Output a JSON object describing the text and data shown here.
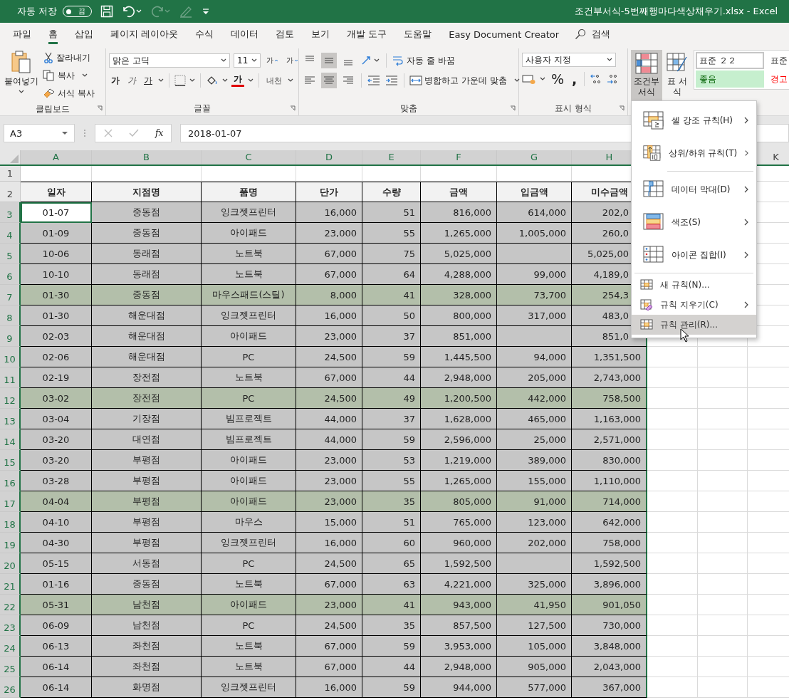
{
  "title_bar": {
    "autosave_label": "자동 저장",
    "autosave_toggle": {
      "label": "끔",
      "on": false
    },
    "quick_access": [
      {
        "kind": "save",
        "disabled": false
      },
      {
        "kind": "undo",
        "disabled": false
      },
      {
        "kind": "redo",
        "disabled": true
      },
      {
        "kind": "pen",
        "disabled": true
      },
      {
        "kind": "customize",
        "disabled": false
      }
    ],
    "title": "조건부서식-5번째행마다색상채우기.xlsx  -  Excel"
  },
  "tabs": [
    {
      "label": "파일",
      "selected": false
    },
    {
      "label": "홈",
      "selected": true
    },
    {
      "label": "삽입",
      "selected": false
    },
    {
      "label": "페이지 레이아웃",
      "selected": false
    },
    {
      "label": "수식",
      "selected": false
    },
    {
      "label": "데이터",
      "selected": false
    },
    {
      "label": "검토",
      "selected": false
    },
    {
      "label": "보기",
      "selected": false
    },
    {
      "label": "개발 도구",
      "selected": false
    },
    {
      "label": "도움말",
      "selected": false
    },
    {
      "label": "Easy Document Creator",
      "selected": false
    }
  ],
  "search": {
    "label": "검색"
  },
  "ribbon": {
    "clipboard": {
      "label": "클립보드",
      "paste": "붙여넣기",
      "cut": "잘라내기",
      "copy": "복사",
      "format_painter": "서식 복사"
    },
    "font": {
      "label": "글꼴",
      "font_name": "맑은 고딕",
      "font_size": "11",
      "grow": "가",
      "shrink": "가",
      "bold": "가",
      "italic": "가",
      "underline": "가",
      "font_color": "가",
      "phonetic": "내천"
    },
    "alignment": {
      "label": "맞춤",
      "vertical": [
        {
          "kind": "top",
          "selected": false
        },
        {
          "kind": "middle",
          "selected": true
        },
        {
          "kind": "bottom",
          "selected": false
        }
      ],
      "horizontal": [
        {
          "kind": "left",
          "selected": false
        },
        {
          "kind": "center",
          "selected": true
        },
        {
          "kind": "right",
          "selected": false
        }
      ],
      "wrap_text": "자동 줄 바꿈",
      "merge_center": "병합하고 가운데 맞춤"
    },
    "number": {
      "label": "표시 형식",
      "format": "사용자 지정",
      "percent": "%",
      "comma": ","
    },
    "styles": {
      "conditional_formatting": {
        "label": "조건부 서식",
        "expanded": true
      },
      "format_as_table": "표 서식",
      "gallery": [
        {
          "label": "표준 ２２",
          "kind": "normal",
          "selected": true
        },
        {
          "label": "표준",
          "kind": "normal",
          "selected": false
        },
        {
          "label": "좋음",
          "kind": "good",
          "selected": false
        },
        {
          "label": "경고",
          "kind": "bad",
          "selected": false
        }
      ]
    }
  },
  "formula_bar": {
    "name_box": "A3",
    "fx": "fx",
    "formula": "2018-01-07"
  },
  "sheet": {
    "columns": [
      {
        "label": "A",
        "selected": true
      },
      {
        "label": "B",
        "selected": true
      },
      {
        "label": "C",
        "selected": true
      },
      {
        "label": "D",
        "selected": true
      },
      {
        "label": "E",
        "selected": true
      },
      {
        "label": "F",
        "selected": true
      },
      {
        "label": "G",
        "selected": true
      },
      {
        "label": "H",
        "selected": true
      },
      {
        "label": "K",
        "selected": false
      }
    ],
    "blank_row_number": "1",
    "header_row_number": "2",
    "headers": [
      "일자",
      "지점명",
      "품명",
      "단가",
      "수량",
      "금액",
      "입금액",
      "미수금액"
    ],
    "rows": [
      {
        "number": "3",
        "highlight": false,
        "active": true,
        "cells": [
          "01-07",
          "중동점",
          "잉크젯프린터",
          "16,000",
          "51",
          "816,000",
          "614,000",
          "202,0"
        ]
      },
      {
        "number": "4",
        "highlight": false,
        "active": false,
        "cells": [
          "01-09",
          "중동점",
          "아이패드",
          "23,000",
          "55",
          "1,265,000",
          "1,005,000",
          "260,0"
        ]
      },
      {
        "number": "5",
        "highlight": false,
        "active": false,
        "cells": [
          "10-06",
          "동래점",
          "노트북",
          "67,000",
          "75",
          "5,025,000",
          null,
          "5,025,00"
        ]
      },
      {
        "number": "6",
        "highlight": false,
        "active": false,
        "cells": [
          "10-10",
          "동래점",
          "노트북",
          "67,000",
          "64",
          "4,288,000",
          "99,000",
          "4,189,0"
        ]
      },
      {
        "number": "7",
        "highlight": true,
        "active": false,
        "cells": [
          "01-30",
          "중동점",
          "마우스패드(스틸)",
          "8,000",
          "41",
          "328,000",
          "73,700",
          "254,3"
        ]
      },
      {
        "number": "8",
        "highlight": false,
        "active": false,
        "cells": [
          "01-30",
          "해운대점",
          "잉크젯프린터",
          "16,000",
          "50",
          "800,000",
          "317,000",
          "483,0"
        ]
      },
      {
        "number": "9",
        "highlight": false,
        "active": false,
        "cells": [
          "02-03",
          "해운대점",
          "아이패드",
          "23,000",
          "37",
          "851,000",
          null,
          "851,0"
        ]
      },
      {
        "number": "10",
        "highlight": false,
        "active": false,
        "cells": [
          "02-06",
          "해운대점",
          "PC",
          "24,500",
          "59",
          "1,445,500",
          "94,000",
          "1,351,500"
        ]
      },
      {
        "number": "11",
        "highlight": false,
        "active": false,
        "cells": [
          "02-19",
          "장전점",
          "노트북",
          "67,000",
          "44",
          "2,948,000",
          "205,000",
          "2,743,000"
        ]
      },
      {
        "number": "12",
        "highlight": true,
        "active": false,
        "cells": [
          "03-02",
          "장전점",
          "PC",
          "24,500",
          "49",
          "1,200,500",
          "442,000",
          "758,500"
        ]
      },
      {
        "number": "13",
        "highlight": false,
        "active": false,
        "cells": [
          "03-04",
          "기장점",
          "빔프로젝트",
          "44,000",
          "37",
          "1,628,000",
          "465,000",
          "1,163,000"
        ]
      },
      {
        "number": "14",
        "highlight": false,
        "active": false,
        "cells": [
          "03-20",
          "대연점",
          "빔프로젝트",
          "44,000",
          "59",
          "2,596,000",
          "25,000",
          "2,571,000"
        ]
      },
      {
        "number": "15",
        "highlight": false,
        "active": false,
        "cells": [
          "03-20",
          "부평점",
          "아이패드",
          "23,000",
          "53",
          "1,219,000",
          "389,000",
          "830,000"
        ]
      },
      {
        "number": "16",
        "highlight": false,
        "active": false,
        "cells": [
          "03-28",
          "부평점",
          "아이패드",
          "23,000",
          "55",
          "1,265,000",
          "155,000",
          "1,110,000"
        ]
      },
      {
        "number": "17",
        "highlight": true,
        "active": false,
        "cells": [
          "04-04",
          "부평점",
          "아이패드",
          "23,000",
          "35",
          "805,000",
          "91,000",
          "714,000"
        ]
      },
      {
        "number": "18",
        "highlight": false,
        "active": false,
        "cells": [
          "04-10",
          "부평점",
          "마우스",
          "15,000",
          "51",
          "765,000",
          "123,000",
          "642,000"
        ]
      },
      {
        "number": "19",
        "highlight": false,
        "active": false,
        "cells": [
          "04-30",
          "부평점",
          "잉크젯프린터",
          "16,000",
          "60",
          "960,000",
          "202,000",
          "758,000"
        ]
      },
      {
        "number": "20",
        "highlight": false,
        "active": false,
        "cells": [
          "05-15",
          "서동점",
          "PC",
          "24,500",
          "65",
          "1,592,500",
          null,
          "1,592,500"
        ]
      },
      {
        "number": "21",
        "highlight": false,
        "active": false,
        "cells": [
          "01-16",
          "중동점",
          "노트북",
          "67,000",
          "63",
          "4,221,000",
          "325,000",
          "3,896,000"
        ]
      },
      {
        "number": "22",
        "highlight": true,
        "active": false,
        "cells": [
          "05-31",
          "남천점",
          "아이패드",
          "23,000",
          "41",
          "943,000",
          "41,950",
          "901,050"
        ]
      },
      {
        "number": "23",
        "highlight": false,
        "active": false,
        "cells": [
          "06-09",
          "남천점",
          "PC",
          "24,500",
          "35",
          "857,500",
          "127,500",
          "730,000"
        ]
      },
      {
        "number": "24",
        "highlight": false,
        "active": false,
        "cells": [
          "06-13",
          "좌천점",
          "노트북",
          "67,000",
          "59",
          "3,953,000",
          "105,000",
          "3,848,000"
        ]
      },
      {
        "number": "25",
        "highlight": false,
        "active": false,
        "cells": [
          "06-14",
          "좌천점",
          "노트북",
          "67,000",
          "44",
          "2,948,000",
          "905,000",
          "2,043,000"
        ]
      },
      {
        "number": "26",
        "highlight": false,
        "active": false,
        "cells": [
          "06-14",
          "화명점",
          "잉크젯프린터",
          "16,000",
          "59",
          "944,000",
          "577,000",
          "367,000"
        ]
      }
    ]
  },
  "menu": {
    "items": [
      {
        "label": "셀 강조 규칙(H)",
        "kind": "large",
        "submenu": true,
        "selected": false
      },
      {
        "label": "상위/하위 규칙(T)",
        "kind": "large",
        "submenu": true,
        "selected": false
      },
      {
        "label": "데이터 막대(D)",
        "kind": "large",
        "submenu": true,
        "selected": false
      },
      {
        "label": "색조(S)",
        "kind": "large",
        "submenu": true,
        "selected": false
      },
      {
        "label": "아이콘 집합(I)",
        "kind": "large",
        "submenu": true,
        "selected": false
      },
      {
        "label": "새 규칙(N)...",
        "kind": "small",
        "submenu": false,
        "selected": false
      },
      {
        "label": "규칙 지우기(C)",
        "kind": "small",
        "submenu": true,
        "selected": false
      },
      {
        "label": "규칙 관리(R)...",
        "kind": "small",
        "submenu": false,
        "selected": true
      }
    ]
  }
}
